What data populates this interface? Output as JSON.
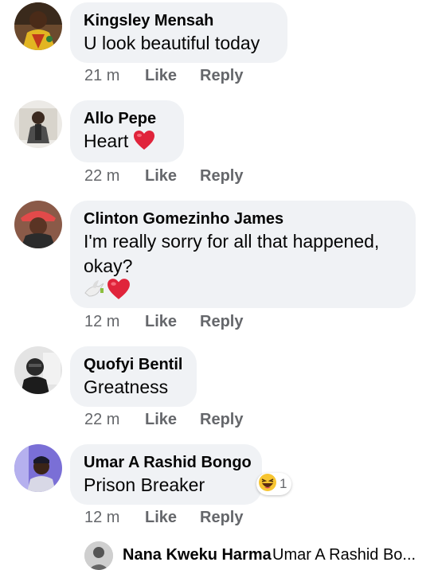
{
  "comments": [
    {
      "name": "Kingsley Mensah",
      "text": "U look beautiful today",
      "time": "21 m",
      "like": "Like",
      "reply": "Reply"
    },
    {
      "name": "Allo Pepe",
      "text": "Heart",
      "time": "22 m",
      "like": "Like",
      "reply": "Reply"
    },
    {
      "name": "Clinton Gomezinho James",
      "text_line1": "I'm really sorry for all that happened,",
      "text_line2": "okay?",
      "time": "12 m",
      "like": "Like",
      "reply": "Reply"
    },
    {
      "name": "Quofyi Bentil",
      "text": "Greatness",
      "time": "22 m",
      "like": "Like",
      "reply": "Reply"
    },
    {
      "name": "Umar A Rashid Bongo",
      "text": "Prison Breaker",
      "time": "12 m",
      "like": "Like",
      "reply": "Reply",
      "reaction_count": "1"
    }
  ],
  "reply_preview": {
    "name": "Nana Kweku Harma",
    "text": "Umar A Rashid Bo..."
  },
  "colors": {
    "bubble": "#f0f2f5",
    "meta": "#65676b",
    "heart": "#e0243b"
  }
}
